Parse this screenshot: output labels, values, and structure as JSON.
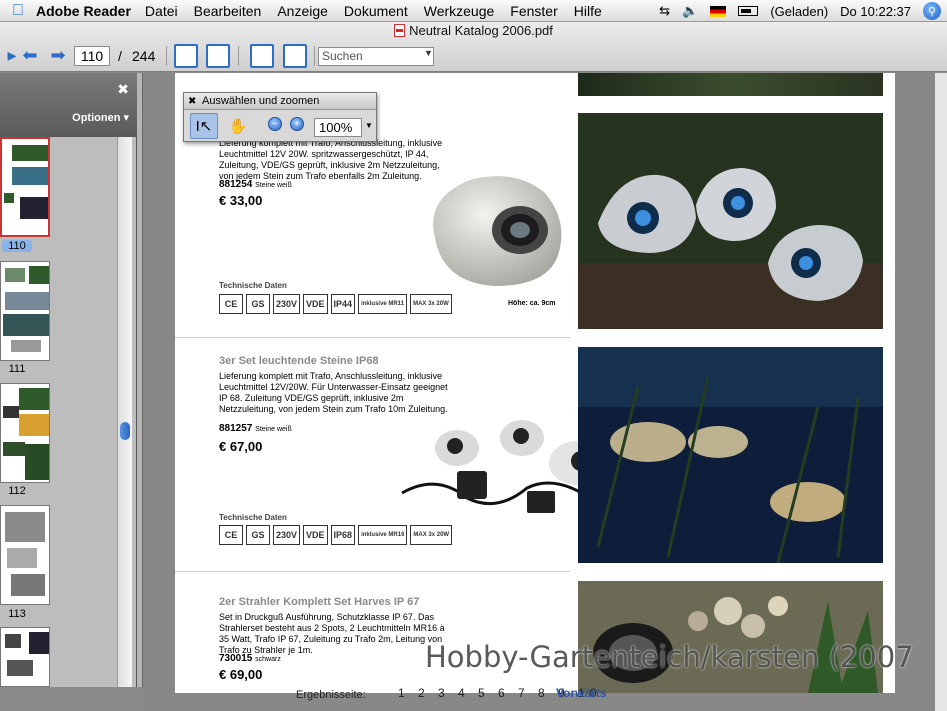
{
  "menubar": {
    "app_name": "Adobe Reader",
    "items": [
      "Datei",
      "Bearbeiten",
      "Anzeige",
      "Dokument",
      "Werkzeuge",
      "Fenster",
      "Hilfe"
    ],
    "battery_status": "(Geladen)",
    "clock": "Do 10:22:37"
  },
  "toolbar": {
    "document_title": "Neutral Katalog 2006.pdf",
    "current_page": "110",
    "page_separator": "/",
    "total_pages": "244",
    "search_placeholder": "Suchen"
  },
  "sidebar": {
    "options_label": "Optionen",
    "pages": [
      {
        "label": "110",
        "selected": true
      },
      {
        "label": "111",
        "selected": false
      },
      {
        "label": "112",
        "selected": false
      },
      {
        "label": "113",
        "selected": false
      }
    ]
  },
  "palette": {
    "title": "Auswählen und zoomen",
    "zoom_value": "100%"
  },
  "catalog": {
    "item1": {
      "description": "Lieferung komplett mit Trafo, Anschlussleitung, inklusive Leuchtmittel 12V 20W. spritzwassergeschützt, IP 44, Zuleitung, VDE/GS geprüft, inklusive 2m Netzzuleitung, von jedem Stein zum Trafo ebenfalls 2m Zuleitung.",
      "sku": "881254",
      "sku_note": "Steine weiß",
      "price": "€ 33,00",
      "tech_label": "Technische Daten",
      "size_note": "Höhe: ca. 9cm",
      "certs": [
        "CE",
        "GS",
        "230V",
        "VDE",
        "IP44",
        "inklusive MR11",
        "MAX 3x 20W"
      ]
    },
    "item2": {
      "title": "3er Set leuchtende Steine IP68",
      "description": "Lieferung komplett mit Trafo, Anschlussleitung, inklusive Leuchtmittel 12V/20W. Für Unterwasser-Einsatz geeignet IP 68. Zuleitung VDE/GS geprüft, inklusive 2m Netzzuleitung, von jedem Stein zum Trafo 10m Zuleitung.",
      "sku": "881257",
      "sku_note": "Steine weiß",
      "price": "€ 67,00",
      "tech_label": "Technische Daten",
      "certs": [
        "CE",
        "GS",
        "230V",
        "VDE",
        "IP68",
        "inklusive MR16",
        "MAX 3x 20W"
      ]
    },
    "item3": {
      "title": "2er Strahler Komplett Set Harves IP 67",
      "description": "Set in Druckguß Ausführung, Schutzklasse IP 67. Das Strahlerset besteht aus 2 Spots, 2 Leuchtmitteln MR16 à 35 Watt, Trafo IP 67, Zuleitung zu Trafo 2m, Leitung von Trafo zu Strahler je 1m.",
      "sku": "730015",
      "sku_note": "schwarz",
      "price": "€ 69,00"
    },
    "footer_label": "Ergebnisseite:",
    "footer_pages": "1 2 3 4 5 6 7 8 9 10",
    "footer_next": "Vorwärts"
  },
  "watermark": "Hobby-Gartenteich/karsten (2007"
}
